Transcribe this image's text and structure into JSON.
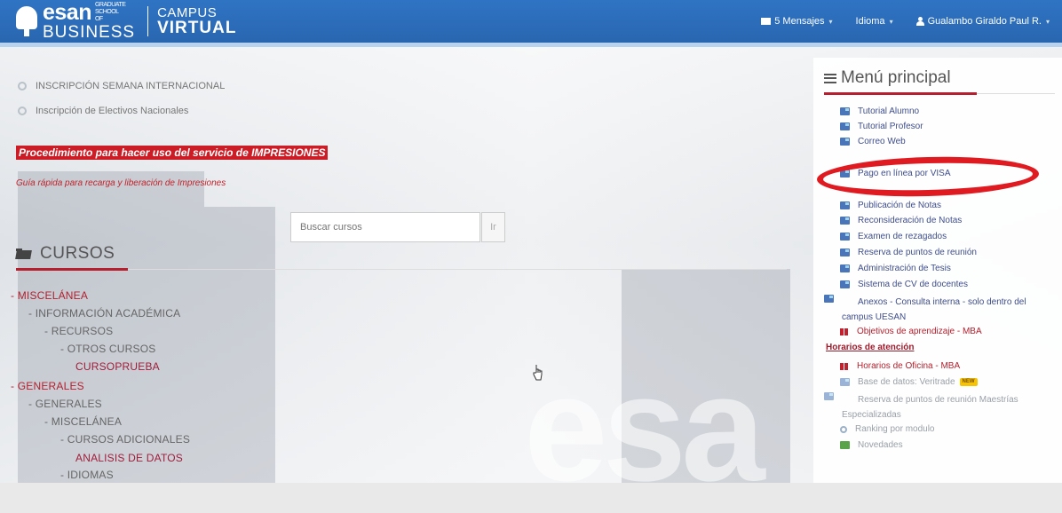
{
  "header": {
    "logo_text": "esan",
    "logo_small": "GRADUATE SCHOOL OF",
    "logo_business": "BUSINESS",
    "campus": "CAMPUS",
    "virtual": "VIRTUAL",
    "messages": "5 Mensajes",
    "language": "Idioma",
    "user": "Gualambo Giraldo Paul R."
  },
  "main": {
    "inscripciones": [
      "INSCRIPCIÓN SEMANA INTERNACIONAL",
      "Inscripción de Electivos Nacionales"
    ],
    "procedimiento_link": "Procedimiento para hacer uso del servicio de IMPRESIONES",
    "guia_link": "Guía rápida para recarga y liberación de Impresiones",
    "search": {
      "placeholder": "Buscar cursos",
      "button": "Ir"
    },
    "cursos_title": "CURSOS",
    "tree": [
      {
        "label": "- MISCELÁNEA",
        "type": "cat"
      },
      {
        "label": "- INFORMACIÓN ACADÉMICA",
        "type": "sub"
      },
      {
        "label": "- RECURSOS",
        "type": "sub"
      },
      {
        "label": "- OTROS CURSOS",
        "type": "sub"
      },
      {
        "label": "CURSOPRUEBA",
        "type": "leaf"
      },
      {
        "label": "- GENERALES",
        "type": "cat"
      },
      {
        "label": "- GENERALES",
        "type": "sub"
      },
      {
        "label": "- MISCELÁNEA",
        "type": "sub"
      },
      {
        "label": "- CURSOS ADICIONALES",
        "type": "sub"
      },
      {
        "label": "ANALISIS DE DATOS",
        "type": "leaf"
      },
      {
        "label": "- IDIOMAS",
        "type": "sub"
      }
    ],
    "watermark": "esa"
  },
  "sidebar": {
    "title": "Menú principal",
    "items": [
      {
        "label": "Tutorial Alumno",
        "icon": "doc-icon",
        "style": "link"
      },
      {
        "label": "Tutorial Profesor",
        "icon": "doc-icon",
        "style": "link"
      },
      {
        "label": "Correo Web",
        "icon": "doc-icon",
        "style": "link"
      },
      {
        "label": "Pago en línea por VISA",
        "icon": "doc-icon",
        "style": "link"
      },
      {
        "label": "Publicación de Notas",
        "icon": "doc-icon",
        "style": "link"
      },
      {
        "label": "Reconsideración de Notas",
        "icon": "doc-icon",
        "style": "link"
      },
      {
        "label": "Examen de rezagados",
        "icon": "doc-icon",
        "style": "link"
      },
      {
        "label": "Reserva de puntos de reunión",
        "icon": "doc-icon",
        "style": "link"
      },
      {
        "label": "Administración de Tesis",
        "icon": "doc-icon",
        "style": "link"
      },
      {
        "label": "Sistema de CV de docentes",
        "icon": "doc-icon",
        "style": "link"
      },
      {
        "label": "Anexos - Consulta interna - solo dentro del campus UESAN",
        "icon": "doc-icon",
        "style": "link"
      },
      {
        "label": "Objetivos de aprendizaje - MBA",
        "icon": "book-icon",
        "style": "red"
      }
    ],
    "horarios_title": "Horarios de atención",
    "horarios_items": [
      {
        "label": "Horarios de Oficina - MBA",
        "icon": "book-icon",
        "style": "red"
      },
      {
        "label": "Base de datos: Veritrade",
        "icon": "doc-icon",
        "style": "gray",
        "badge": "NEW"
      },
      {
        "label": "Reserva de puntos de reunión Maestrías Especializadas",
        "icon": "doc-icon",
        "style": "gray"
      },
      {
        "label": "Ranking por modulo",
        "icon": "ring-icon",
        "style": "gray"
      },
      {
        "label": "Novedades",
        "icon": "chat-icon",
        "style": "gray"
      }
    ]
  },
  "colors": {
    "navbar": "#2c6fbd",
    "accent": "#b51f2e",
    "annotation": "#e01a21"
  }
}
